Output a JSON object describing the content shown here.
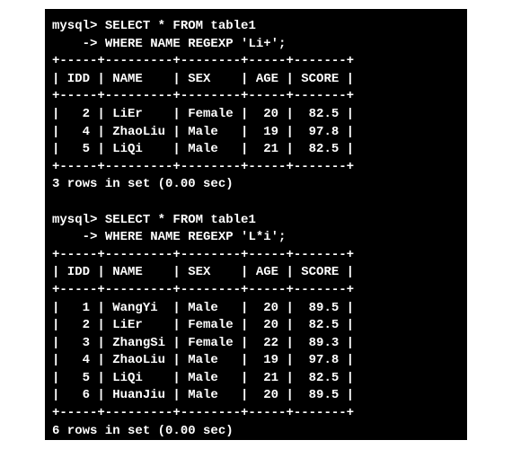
{
  "query1": {
    "prompt": "mysql> ",
    "line1": "SELECT * FROM table1",
    "cont_prompt": "    -> ",
    "line2": "WHERE NAME REGEXP 'Li+';",
    "border": "+-----+---------+--------+-----+-------+",
    "header": "| IDD | NAME    | SEX    | AGE | SCORE |",
    "rows": [
      "|   2 | LiEr    | Female |  20 |  82.5 |",
      "|   4 | ZhaoLiu | Male   |  19 |  97.8 |",
      "|   5 | LiQi    | Male   |  21 |  82.5 |"
    ],
    "result": "3 rows in set (0.00 sec)"
  },
  "query2": {
    "prompt": "mysql> ",
    "line1": "SELECT * FROM table1",
    "cont_prompt": "    -> ",
    "line2": "WHERE NAME REGEXP 'L*i';",
    "border": "+-----+---------+--------+-----+-------+",
    "header": "| IDD | NAME    | SEX    | AGE | SCORE |",
    "rows": [
      "|   1 | WangYi  | Male   |  20 |  89.5 |",
      "|   2 | LiEr    | Female |  20 |  82.5 |",
      "|   3 | ZhangSi | Female |  22 |  89.3 |",
      "|   4 | ZhaoLiu | Male   |  19 |  97.8 |",
      "|   5 | LiQi    | Male   |  21 |  82.5 |",
      "|   6 | HuanJiu | Male   |  20 |  89.5 |"
    ],
    "result": "6 rows in set (0.00 sec)"
  },
  "chart_data": {
    "type": "table",
    "tables": [
      {
        "query": "SELECT * FROM table1 WHERE NAME REGEXP 'Li+';",
        "columns": [
          "IDD",
          "NAME",
          "SEX",
          "AGE",
          "SCORE"
        ],
        "rows": [
          [
            2,
            "LiEr",
            "Female",
            20,
            82.5
          ],
          [
            4,
            "ZhaoLiu",
            "Male",
            19,
            97.8
          ],
          [
            5,
            "LiQi",
            "Male",
            21,
            82.5
          ]
        ],
        "result_meta": "3 rows in set (0.00 sec)"
      },
      {
        "query": "SELECT * FROM table1 WHERE NAME REGEXP 'L*i';",
        "columns": [
          "IDD",
          "NAME",
          "SEX",
          "AGE",
          "SCORE"
        ],
        "rows": [
          [
            1,
            "WangYi",
            "Male",
            20,
            89.5
          ],
          [
            2,
            "LiEr",
            "Female",
            20,
            82.5
          ],
          [
            3,
            "ZhangSi",
            "Female",
            22,
            89.3
          ],
          [
            4,
            "ZhaoLiu",
            "Male",
            19,
            97.8
          ],
          [
            5,
            "LiQi",
            "Male",
            21,
            82.5
          ],
          [
            6,
            "HuanJiu",
            "Male",
            20,
            89.5
          ]
        ],
        "result_meta": "6 rows in set (0.00 sec)"
      }
    ]
  }
}
